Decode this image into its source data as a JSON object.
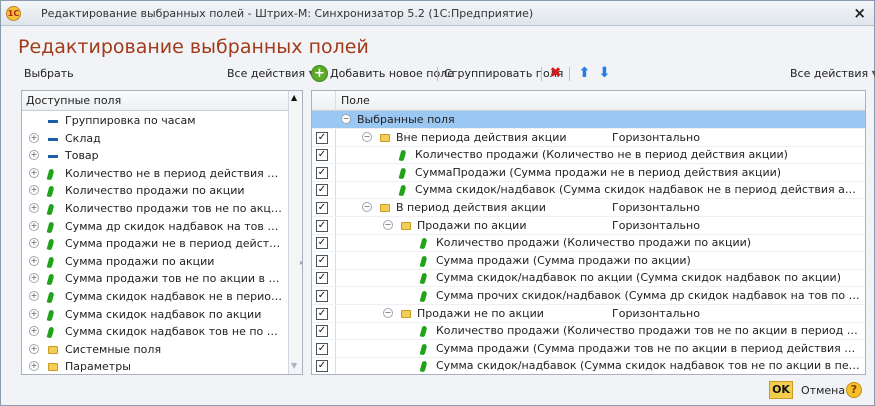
{
  "window": {
    "title": "Редактирование выбранных полей - Штрих-М: Синхронизатор 5.2  (1С:Предприятие)",
    "icon": "1c-icon",
    "close_icon": "×"
  },
  "form": {
    "title": "Редактирование выбранных полей"
  },
  "left_toolbar": {
    "select_label": "Выбрать",
    "all_actions_label": "Все действия"
  },
  "right_toolbar": {
    "add_label": "Добавить новое поле",
    "group_label": "Сгруппировать поля",
    "all_actions_label": "Все действия",
    "delete_icon": "delete-icon",
    "up_icon": "arrow-up-icon",
    "down_icon": "arrow-down-icon"
  },
  "available_fields": {
    "header": "Доступные поля",
    "rows": [
      {
        "label": "Группировка по часам",
        "expandable": false,
        "icon": "dash"
      },
      {
        "label": "Склад",
        "expandable": true,
        "icon": "dash"
      },
      {
        "label": "Товар",
        "expandable": true,
        "icon": "dash"
      },
      {
        "label": "Количество не в период действия акции",
        "expandable": true,
        "icon": "leaf"
      },
      {
        "label": "Количество продажи по акции",
        "expandable": true,
        "icon": "leaf"
      },
      {
        "label": "Количество продажи тов не по акции в пери...",
        "expandable": true,
        "icon": "leaf"
      },
      {
        "label": "Сумма др скидок надбавок на тов по акции",
        "expandable": true,
        "icon": "leaf"
      },
      {
        "label": "Сумма продажи не в период действия акции",
        "expandable": true,
        "icon": "leaf"
      },
      {
        "label": "Сумма продажи по акции",
        "expandable": true,
        "icon": "leaf"
      },
      {
        "label": "Сумма продажи тов не по акции в период де...",
        "expandable": true,
        "icon": "leaf"
      },
      {
        "label": "Сумма скидок надбавок не в период действ...",
        "expandable": true,
        "icon": "leaf"
      },
      {
        "label": "Сумма скидок надбавок по акции",
        "expandable": true,
        "icon": "leaf"
      },
      {
        "label": "Сумма скидок надбавок тов не по акции в п...",
        "expandable": true,
        "icon": "leaf"
      },
      {
        "label": "Системные поля",
        "expandable": true,
        "icon": "folder"
      },
      {
        "label": "Параметры",
        "expandable": true,
        "icon": "folder"
      }
    ]
  },
  "selected_fields": {
    "header": "Поле",
    "rows": [
      {
        "checked": false,
        "level": 0,
        "icon": "",
        "expand": "−",
        "label": "Выбранные поля",
        "layout": ""
      },
      {
        "checked": true,
        "level": 1,
        "icon": "folder",
        "expand": "−",
        "label": "Вне периода действия акции",
        "layout": "Горизонтально"
      },
      {
        "checked": true,
        "level": 2,
        "icon": "leaf",
        "expand": "",
        "label": "Количество продажи (Количество не в период действия акции)",
        "layout": ""
      },
      {
        "checked": true,
        "level": 2,
        "icon": "leaf",
        "expand": "",
        "label": "СуммаПродажи (Сумма продажи не в период действия акции)",
        "layout": ""
      },
      {
        "checked": true,
        "level": 2,
        "icon": "leaf",
        "expand": "",
        "label": "Сумма скидок/надбавок (Сумма скидок надбавок не в период действия акции)",
        "layout": ""
      },
      {
        "checked": true,
        "level": 1,
        "icon": "folder",
        "expand": "−",
        "label": "В период действия акции",
        "layout": "Горизонтально"
      },
      {
        "checked": true,
        "level": 2,
        "icon": "folder",
        "expand": "−",
        "label": "Продажи по акции",
        "layout": "Горизонтально"
      },
      {
        "checked": true,
        "level": 3,
        "icon": "leaf",
        "expand": "",
        "label": "Количество продажи (Количество продажи по акции)",
        "layout": ""
      },
      {
        "checked": true,
        "level": 3,
        "icon": "leaf",
        "expand": "",
        "label": "Сумма продажи (Сумма продажи по акции)",
        "layout": ""
      },
      {
        "checked": true,
        "level": 3,
        "icon": "leaf",
        "expand": "",
        "label": "Сумма скидок/надбавок по акции (Сумма скидок надбавок по акции)",
        "layout": ""
      },
      {
        "checked": true,
        "level": 3,
        "icon": "leaf",
        "expand": "",
        "label": "Сумма прочих скидок/надбавок (Сумма др скидок надбавок на тов по акции)",
        "layout": ""
      },
      {
        "checked": true,
        "level": 2,
        "icon": "folder",
        "expand": "−",
        "label": "Продажи не по акции",
        "layout": "Горизонтально"
      },
      {
        "checked": true,
        "level": 3,
        "icon": "leaf",
        "expand": "",
        "label": "Количество продажи (Количество продажи тов не по акции в период действия акции)",
        "layout": ""
      },
      {
        "checked": true,
        "level": 3,
        "icon": "leaf",
        "expand": "",
        "label": "Сумма продажи (Сумма продажи тов не по акции в период действия акции)",
        "layout": ""
      },
      {
        "checked": true,
        "level": 3,
        "icon": "leaf",
        "expand": "",
        "label": "Сумма скидок/надбавок (Сумма скидок надбавок тов не по акции в период действия ак...",
        "layout": ""
      }
    ]
  },
  "buttons": {
    "ok": "OK",
    "cancel": "Отмена",
    "help": "?"
  }
}
